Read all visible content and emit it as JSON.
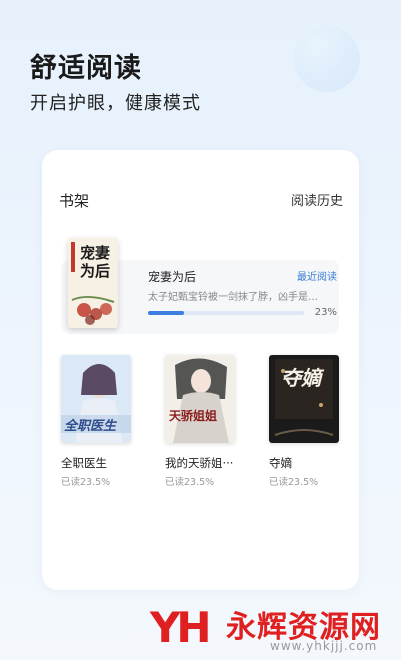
{
  "header": {
    "headline": "舒适阅读",
    "subline": "开启护眼，健康模式"
  },
  "shelf": {
    "title": "书架",
    "history_label": "阅读历史",
    "recent": {
      "cover_text": "宠妻为后",
      "title": "宠妻为后",
      "badge": "最近阅读",
      "description": "太子妃甄宝铃被一剑抹了脖，凶手是她···",
      "progress_label": "23%",
      "progress": 0.23
    },
    "books": [
      {
        "title": "全职医生",
        "progress_label": "已读23.5%",
        "cover_text": "全职医生",
        "cover_colors": [
          "#d6e6f7",
          "#b8cde6"
        ]
      },
      {
        "title": "我的天骄姐···",
        "progress_label": "已读23.5%",
        "cover_text": "天骄姐姐",
        "cover_colors": [
          "#f3efe9",
          "#cfc6bb"
        ]
      },
      {
        "title": "夺嫡",
        "progress_label": "已读23.5%",
        "cover_text": "夺嫡",
        "cover_colors": [
          "#1c1c1c",
          "#2e2a26"
        ]
      }
    ]
  },
  "watermark": {
    "logo": "YH",
    "name": "永辉资源网",
    "url": "www.yhkjjj.com"
  }
}
